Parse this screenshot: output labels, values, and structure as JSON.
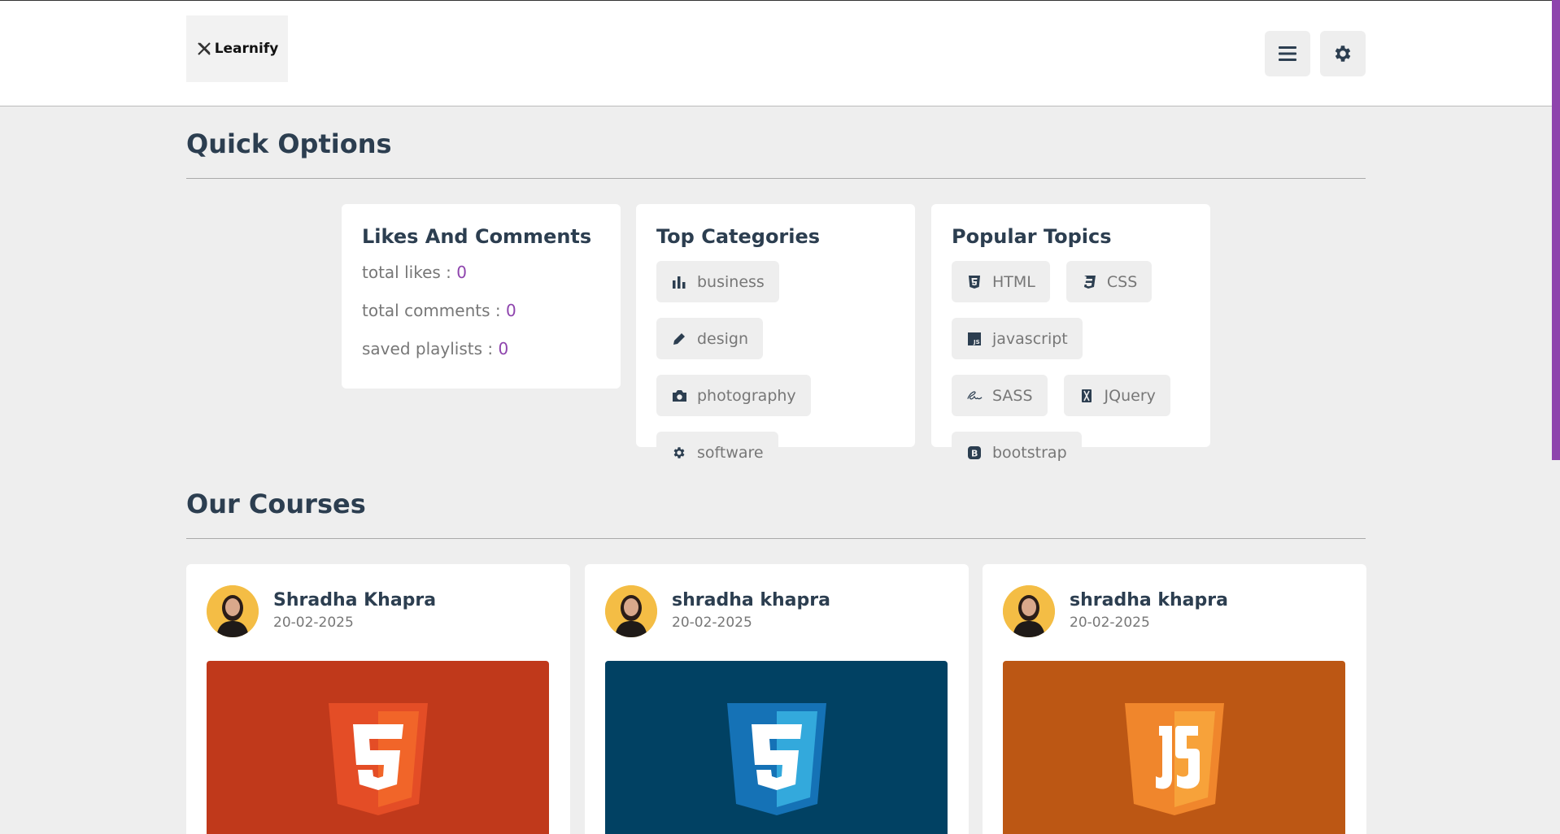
{
  "header": {
    "logo_text": "Learnify",
    "menu_icon": "bars-icon",
    "settings_icon": "gear-icon"
  },
  "quick_options": {
    "title": "Quick Options",
    "likes_box": {
      "title": "Likes And Comments",
      "stats": [
        {
          "label": "total likes : ",
          "value": "0"
        },
        {
          "label": "total comments : ",
          "value": "0"
        },
        {
          "label": "saved playlists : ",
          "value": "0"
        }
      ]
    },
    "categories_box": {
      "title": "Top Categories",
      "items": [
        {
          "label": "business",
          "icon": "chart-bar-icon"
        },
        {
          "label": "design",
          "icon": "pencil-icon"
        },
        {
          "label": "photography",
          "icon": "camera-icon"
        },
        {
          "label": "software",
          "icon": "gear-icon"
        }
      ]
    },
    "topics_box": {
      "title": "Popular Topics",
      "items": [
        {
          "label": "HTML",
          "icon": "html5-icon"
        },
        {
          "label": "CSS",
          "icon": "css3-icon"
        },
        {
          "label": "javascript",
          "icon": "js-icon"
        },
        {
          "label": "SASS",
          "icon": "sass-icon"
        },
        {
          "label": "JQuery",
          "icon": "jquery-icon"
        },
        {
          "label": "bootstrap",
          "icon": "bootstrap-icon"
        }
      ]
    }
  },
  "courses": {
    "title": "Our Courses",
    "items": [
      {
        "tutor": "Shradha Khapra",
        "date": "20-02-2025",
        "thumb_icon": "html5-logo-icon",
        "thumb_color": "#c0391b"
      },
      {
        "tutor": "shradha khapra",
        "date": "20-02-2025",
        "thumb_icon": "css3-logo-icon",
        "thumb_color": "#014163"
      },
      {
        "tutor": "shradha khapra",
        "date": "20-02-2025",
        "thumb_icon": "js-logo-icon",
        "thumb_color": "#bc5714"
      }
    ]
  },
  "colors": {
    "accent": "#8e44ad",
    "text_dark": "#2c3e50",
    "background": "#eeeeee"
  }
}
